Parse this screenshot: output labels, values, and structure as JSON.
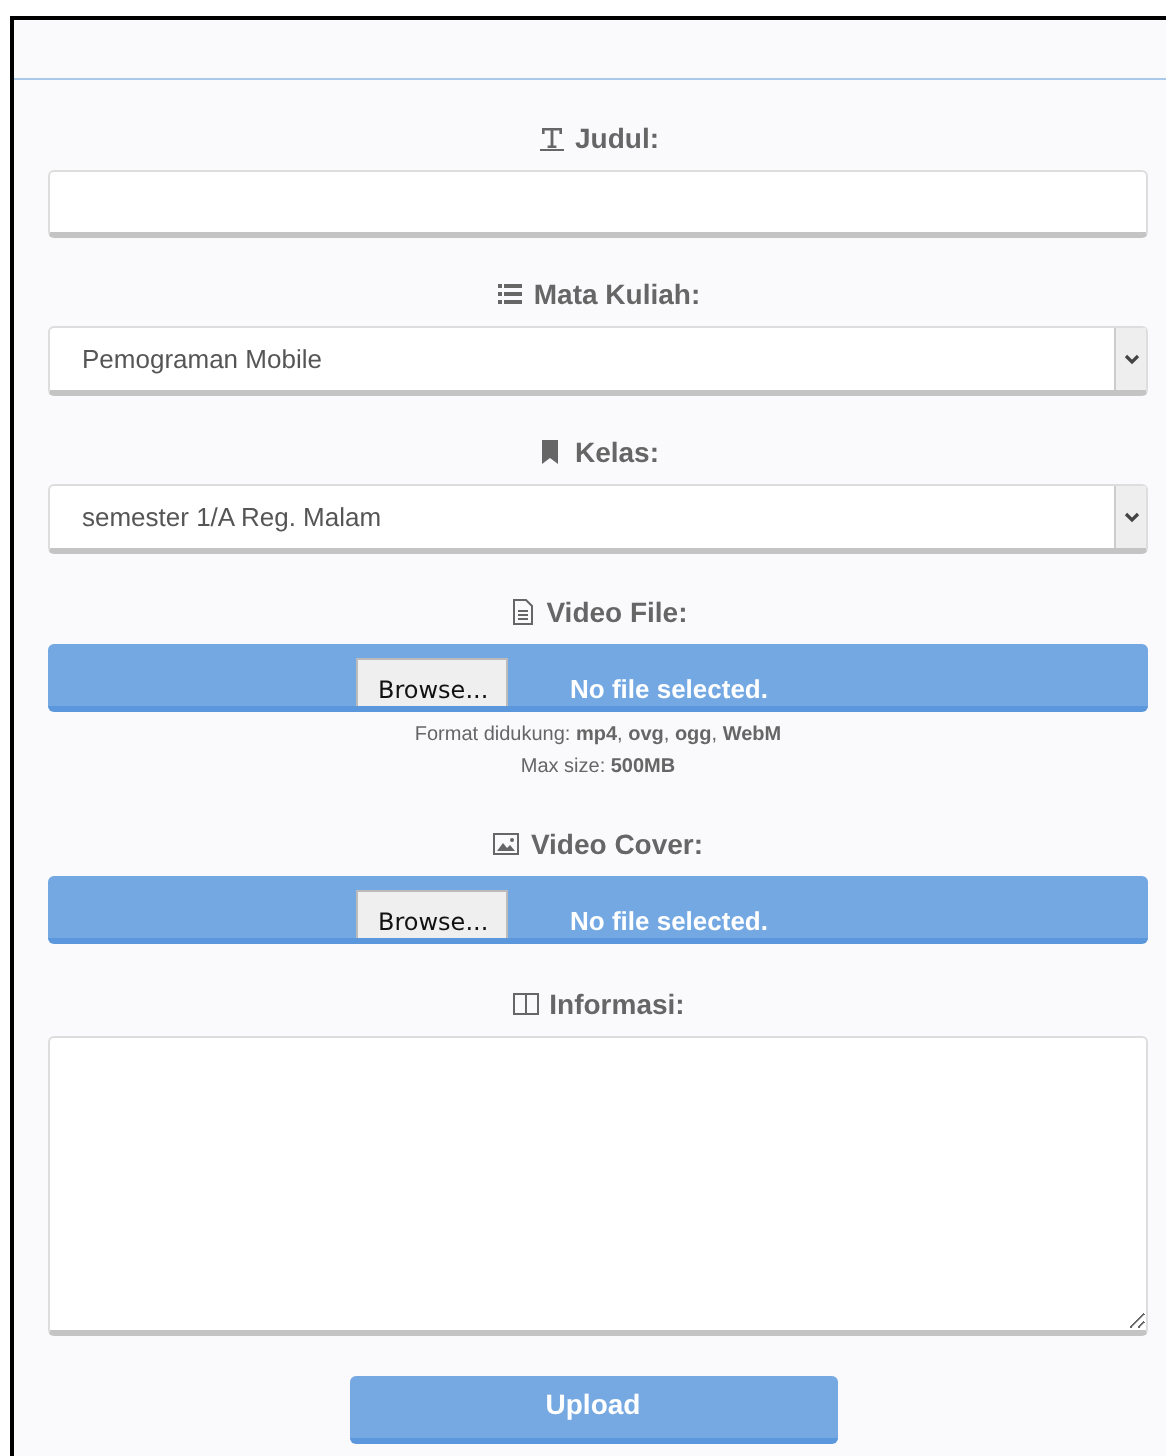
{
  "fields": [
    {
      "kind": "text",
      "label": "Judul:"
    },
    {
      "kind": "select",
      "label": "Mata Kuliah:",
      "value": "Pemograman Mobile"
    },
    {
      "kind": "select",
      "label": "Kelas:",
      "value": "semester 1/A Reg. Malam"
    },
    {
      "kind": "file",
      "label": "Video File:",
      "button": "Browse...",
      "status": "No file selected.",
      "hints": [
        "Format didukung: **mp4**, **ovg**, **ogg**, **WebM**",
        "Max size: **500MB**"
      ]
    },
    {
      "kind": "file",
      "label": "Video Cover:",
      "button": "Browse...",
      "status": "No file selected."
    },
    {
      "kind": "textarea",
      "label": "Informasi:"
    }
  ],
  "submit": "Upload"
}
